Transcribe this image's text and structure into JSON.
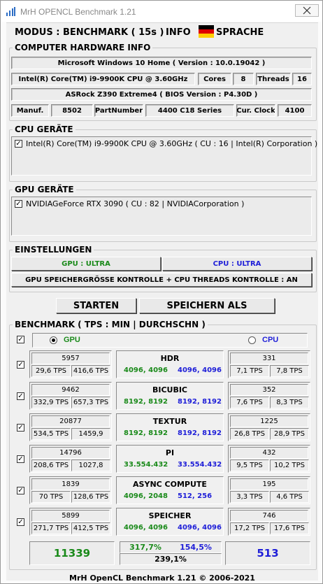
{
  "window": {
    "title": "MrH OPENCL Benchmark 1.21",
    "close_icon": "close-x"
  },
  "header": {
    "mode": "MODUS : BENCHMARK ( 15s )",
    "info": "INFO",
    "language": "SPRACHE",
    "flag_colors": [
      "#000000",
      "#dd0000",
      "#ffce00"
    ]
  },
  "hardware": {
    "legend": "COMPUTER HARDWARE INFO",
    "os": "Microsoft Windows 10 Home ( Version : 10.0.19042 )",
    "cpu": "Intel(R) Core(TM) i9-9900K CPU @ 3.60GHz",
    "cores_label": "Cores",
    "cores_value": "8",
    "threads_label": "Threads",
    "threads_value": "16",
    "board": "ASRock Z390 Extreme4 ( BIOS Version : P4.30D )",
    "manuf_label": "Manuf.",
    "manuf_value": "8502",
    "partnumber_label": "PartNumber",
    "partnumber_value": "4400 C18 Series",
    "clock_label": "Cur. Clock",
    "clock_value": "4100"
  },
  "cpu_devices": {
    "legend": "CPU GERÄTE",
    "items": [
      {
        "label": "Intel(R) Core(TM) i9-9900K CPU @ 3.60GHz ( CU : 16 | Intel(R) Corporation )",
        "checked": true
      }
    ]
  },
  "gpu_devices": {
    "legend": "GPU GERÄTE",
    "items": [
      {
        "label": "NVIDIAGeForce RTX 3090 ( CU : 82 | NVIDIACorporation )",
        "checked": true
      }
    ]
  },
  "settings": {
    "legend": "EINSTELLUNGEN",
    "gpu_preset": "GPU : ULTRA",
    "cpu_preset": "CPU : ULTRA",
    "memory_control": "GPU SPEICHERGRÖSSE KONTROLLE + CPU THREADS KONTROLLE : AN"
  },
  "actions": {
    "start": "STARTEN",
    "save_as": "SPEICHERN ALS"
  },
  "benchmark": {
    "legend": "BENCHMARK ( TPS : MIN | DURCHSCHN )",
    "gpu_label": "GPU",
    "cpu_label": "CPU",
    "selected": "GPU",
    "colors": {
      "gpu": "#1a8a1a",
      "cpu": "#1e1ed8"
    },
    "rows": [
      {
        "name": "HDR",
        "gpu_score": "5957",
        "gpu_min": "29,6 TPS",
        "gpu_avg": "416,6 TPS",
        "gpu_size": "4096, 4096",
        "cpu_size": "4096, 4096",
        "cpu_score": "331",
        "cpu_min": "7,1 TPS",
        "cpu_avg": "7,8 TPS",
        "checked": true
      },
      {
        "name": "BICUBIC",
        "gpu_score": "9462",
        "gpu_min": "332,9 TPS",
        "gpu_avg": "657,3 TPS",
        "gpu_size": "8192, 8192",
        "cpu_size": "8192, 8192",
        "cpu_score": "352",
        "cpu_min": "7,6 TPS",
        "cpu_avg": "8,3 TPS",
        "checked": true
      },
      {
        "name": "TEXTUR",
        "gpu_score": "20877",
        "gpu_min": "534,5 TPS",
        "gpu_avg": "1459,9",
        "gpu_size": "8192, 8192",
        "cpu_size": "8192, 8192",
        "cpu_score": "1225",
        "cpu_min": "26,8 TPS",
        "cpu_avg": "28,9 TPS",
        "checked": true
      },
      {
        "name": "PI",
        "gpu_score": "14796",
        "gpu_min": "208,6 TPS",
        "gpu_avg": "1027,8",
        "gpu_size": "33.554.432",
        "cpu_size": "33.554.432",
        "cpu_score": "432",
        "cpu_min": "9,5 TPS",
        "cpu_avg": "10,2 TPS",
        "checked": true
      },
      {
        "name": "ASYNC COMPUTE",
        "gpu_score": "1839",
        "gpu_min": "70 TPS",
        "gpu_avg": "128,6 TPS",
        "gpu_size": "4096, 2048",
        "cpu_size": "512, 256",
        "cpu_score": "195",
        "cpu_min": "3,3 TPS",
        "cpu_avg": "4,6 TPS",
        "checked": true
      },
      {
        "name": "SPEICHER",
        "gpu_score": "5899",
        "gpu_min": "271,7 TPS",
        "gpu_avg": "412,5 TPS",
        "gpu_size": "4096, 4096",
        "cpu_size": "4096, 4096",
        "cpu_score": "746",
        "cpu_min": "17,2 TPS",
        "cpu_avg": "17,6 TPS",
        "checked": true
      }
    ],
    "totals": {
      "gpu_total": "11339",
      "gpu_percent": "317,7%",
      "cpu_percent": "154,5%",
      "combined_percent": "239,1%",
      "cpu_total": "513"
    }
  },
  "footer": "MrH OpenCL Benchmark 1.21  ©  2006-2021"
}
